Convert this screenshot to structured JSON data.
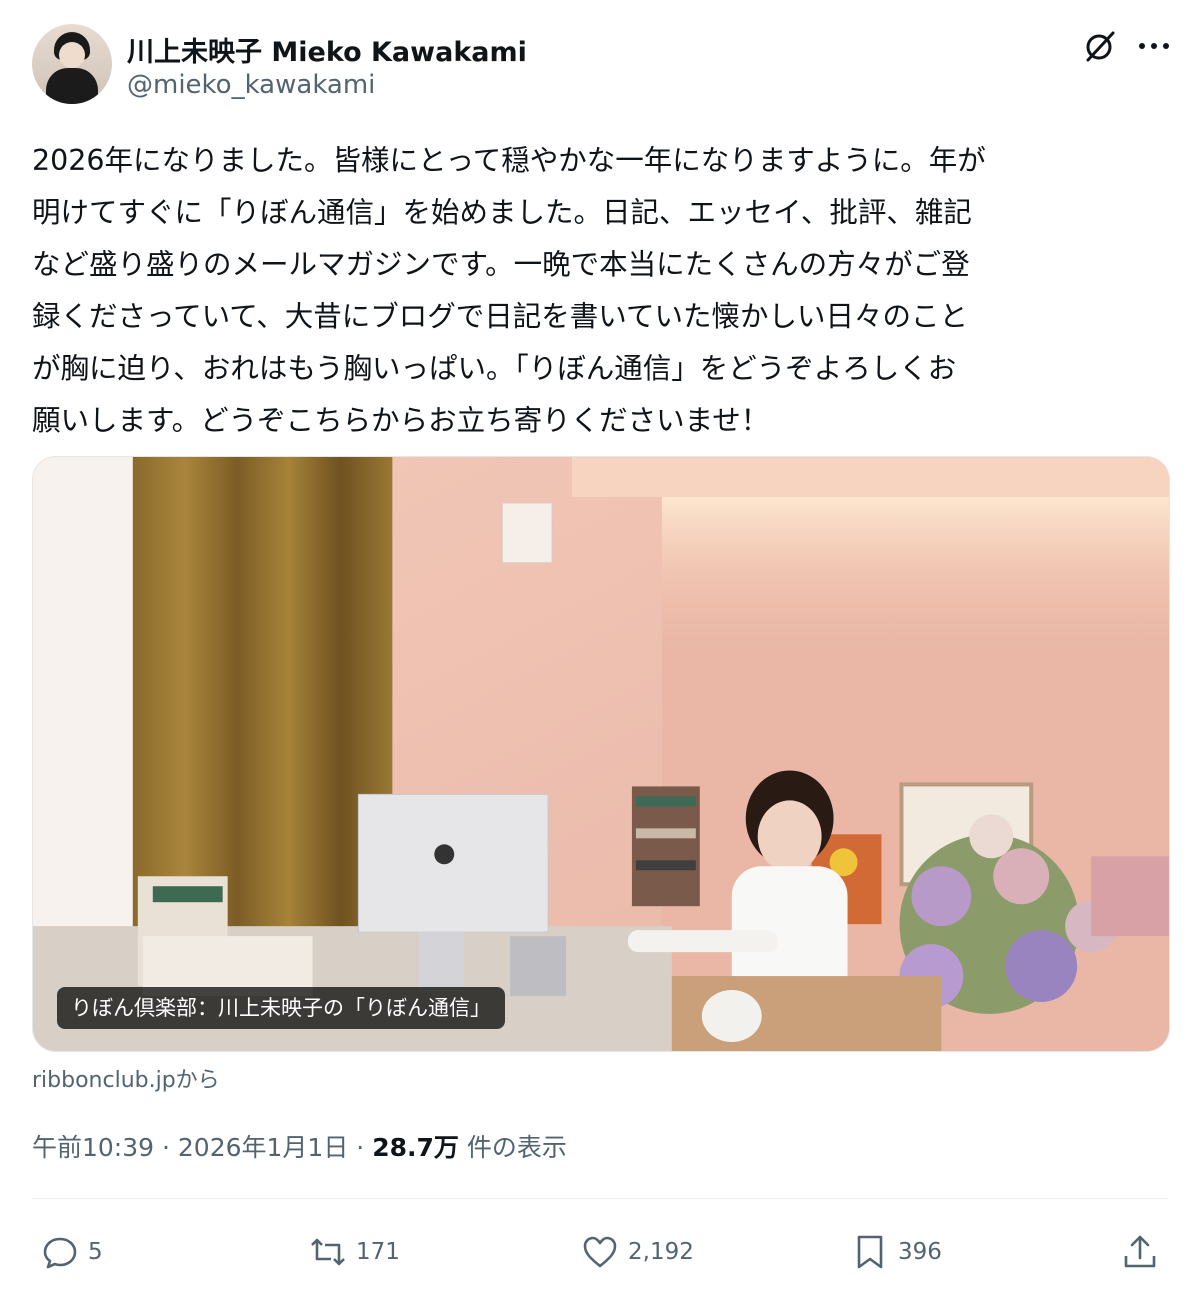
{
  "author": {
    "display_name": "川上未映子 Mieko Kawakami",
    "handle": "@mieko_kawakami"
  },
  "icons": {
    "grok": "grok-icon",
    "more": "more-dots-icon",
    "reply": "reply-bubble-icon",
    "retweet": "retweet-icon",
    "like": "heart-icon",
    "bookmark": "bookmark-icon",
    "share": "share-upload-icon"
  },
  "tweet": {
    "text": "2026年になりました。皆様にとって穏やかな一年になりますように。年が\n明けてすぐに「りぼん通信」を始めました。日記、エッセイ、批評、雑記\nなど盛り盛りのメールマガジンです。一晩で本当にたくさんの方々がご登\n録くださっていて、大昔にブログで日記を書いていた懐かしい日々のこと\nが胸に迫り、おれはもう胸いっぱい。「りぼん通信」をどうぞよろしくお\n願いします。どうぞこちらからお立ち寄りくださいませ！"
  },
  "link_card": {
    "caption": "りぼん倶楽部：川上未映子の「りぼん通信」",
    "source": "ribbonclub.jpから"
  },
  "meta": {
    "time": "午前10:39",
    "date": "2026年1月1日",
    "views_count": "28.7万",
    "views_label": "件の表示"
  },
  "actions": {
    "replies": "5",
    "retweets": "171",
    "likes": "2,192",
    "bookmarks": "396"
  },
  "colors": {
    "text": "#0f1419",
    "secondary": "#536471",
    "divider": "#eff3f4"
  }
}
